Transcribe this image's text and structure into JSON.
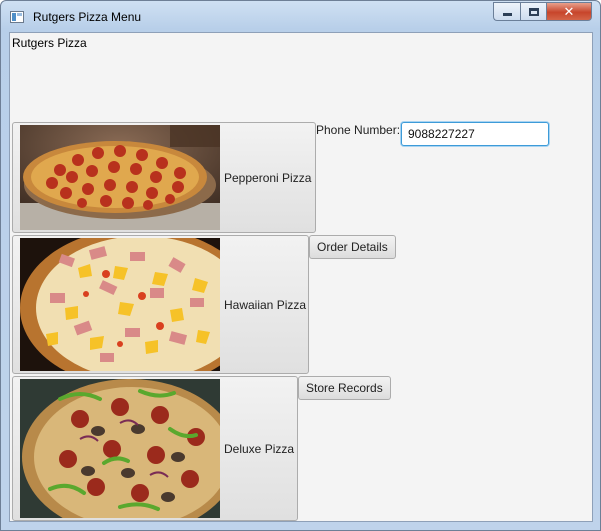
{
  "window": {
    "title": "Rutgers Pizza Menu"
  },
  "app": {
    "heading": "Rutgers Pizza"
  },
  "menu": {
    "items": [
      {
        "label": "Pepperoni Pizza"
      },
      {
        "label": "Hawaiian Pizza"
      },
      {
        "label": "Deluxe Pizza"
      }
    ]
  },
  "phone": {
    "label": "Phone Number:",
    "value": "9088227227"
  },
  "actions": {
    "order_details": "Order Details",
    "store_records": "Store Records"
  },
  "controls": {
    "close_glyph": "✕"
  }
}
